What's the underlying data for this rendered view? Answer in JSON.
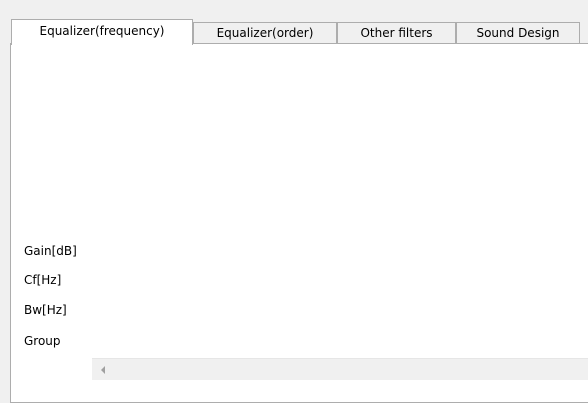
{
  "tabs": [
    {
      "label": "Equalizer(frequency)",
      "active": true
    },
    {
      "label": "Equalizer(order)",
      "active": false
    },
    {
      "label": "Other filters",
      "active": false
    },
    {
      "label": "Sound Design",
      "active": false
    }
  ],
  "rows": {
    "gain": "Gain[dB]",
    "cf": "Cf[Hz]",
    "bw": "Bw[Hz]",
    "group": "Group"
  },
  "icons": {
    "scroll_left": "chevron-left-icon"
  },
  "colors": {
    "panel_bg": "#ffffff",
    "window_bg": "#f0f0f0",
    "border": "#adadad"
  }
}
